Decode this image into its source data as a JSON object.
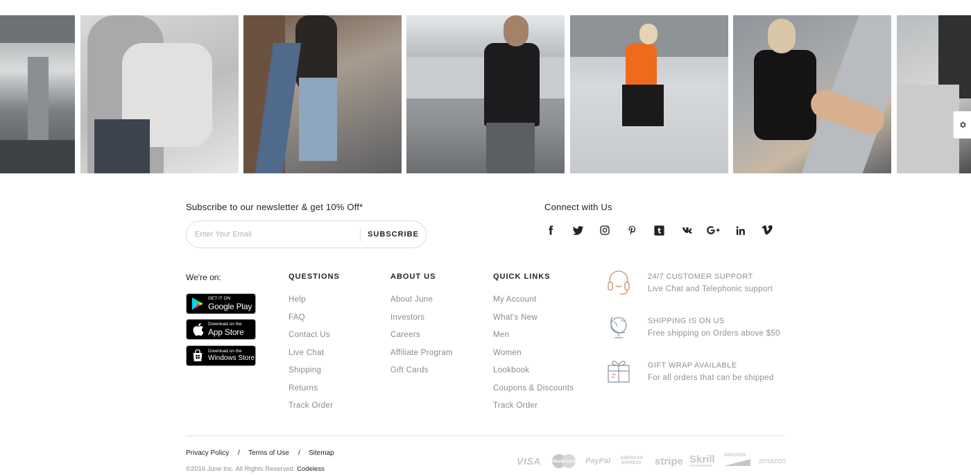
{
  "gallery": {
    "photos": [
      "concrete-architecture-photo",
      "woman-with-white-backpack-photo",
      "woman-in-ripped-jeans-photo",
      "man-in-black-sweater-photo",
      "woman-in-orange-top-walking-photo",
      "woman-in-leather-jacket-sitting-photo",
      "knit-blanket-photo"
    ]
  },
  "newsletter": {
    "title": "Subscribe to our newsletter & get 10% Off*",
    "placeholder": "Enter Your Email",
    "button_label": "SUBSCRIBE"
  },
  "connect": {
    "title": "Connect with Us",
    "icons": [
      "facebook-icon",
      "twitter-icon",
      "instagram-icon",
      "pinterest-icon",
      "tumblr-icon",
      "vk-icon",
      "google-plus-icon",
      "linkedin-icon",
      "vimeo-icon"
    ]
  },
  "apps": {
    "title": "We're on:",
    "google_play": {
      "small": "GET IT ON",
      "big": "Google Play"
    },
    "app_store": {
      "small": "Download on the",
      "big": "App Store"
    },
    "windows_store": {
      "small": "Download on the",
      "big": "Windows Store"
    }
  },
  "columns": [
    {
      "title": "QUESTIONS",
      "links": [
        "Help",
        "FAQ",
        "Contact Us",
        "Live Chat",
        "Shipping",
        "Returns",
        "Track Order"
      ]
    },
    {
      "title": "ABOUT US",
      "links": [
        "About June",
        "Investors",
        "Careers",
        "Affiliate Program",
        "Gift Cards"
      ]
    },
    {
      "title": "QUICK LINKS",
      "links": [
        "My Account",
        "What's New",
        "Men",
        "Women",
        "Lookbook",
        "Coupons & Discounts",
        "Track Order"
      ]
    }
  ],
  "features": [
    {
      "icon": "headset-icon",
      "title": "24/7 CUSTOMER SUPPORT",
      "desc": "Live Chat and Telephonic support"
    },
    {
      "icon": "globe-icon",
      "title": "SHIPPING IS ON US",
      "desc": "Free shipping on Orders above $50"
    },
    {
      "icon": "gift-box-icon",
      "title": "GIFT WRAP AVAILABLE",
      "desc": "For all orders that can be shipped"
    }
  ],
  "legal": {
    "privacy": "Privacy Policy",
    "terms": "Terms of Use",
    "sitemap": "Sitemap",
    "separator": "/",
    "copyright": "©2016 June Inc. All Rights Reserved.",
    "credit": "Codeless"
  },
  "payments": {
    "visa": "VISA",
    "paypal": "PayPal",
    "amex_top": "AMERICAN",
    "amex_bottom": "EXPRESS",
    "stripe": "stripe",
    "skrill": "Skrill",
    "skrill_sub": "moneybookers",
    "discover": "DISCOVER",
    "amazon": "amazon"
  },
  "colors": {
    "accent_icon": "#c98c6f",
    "feature_icon": "#8f98a5",
    "muted_text": "#8a8a8a",
    "payment_logo": "#c3c6ca"
  }
}
